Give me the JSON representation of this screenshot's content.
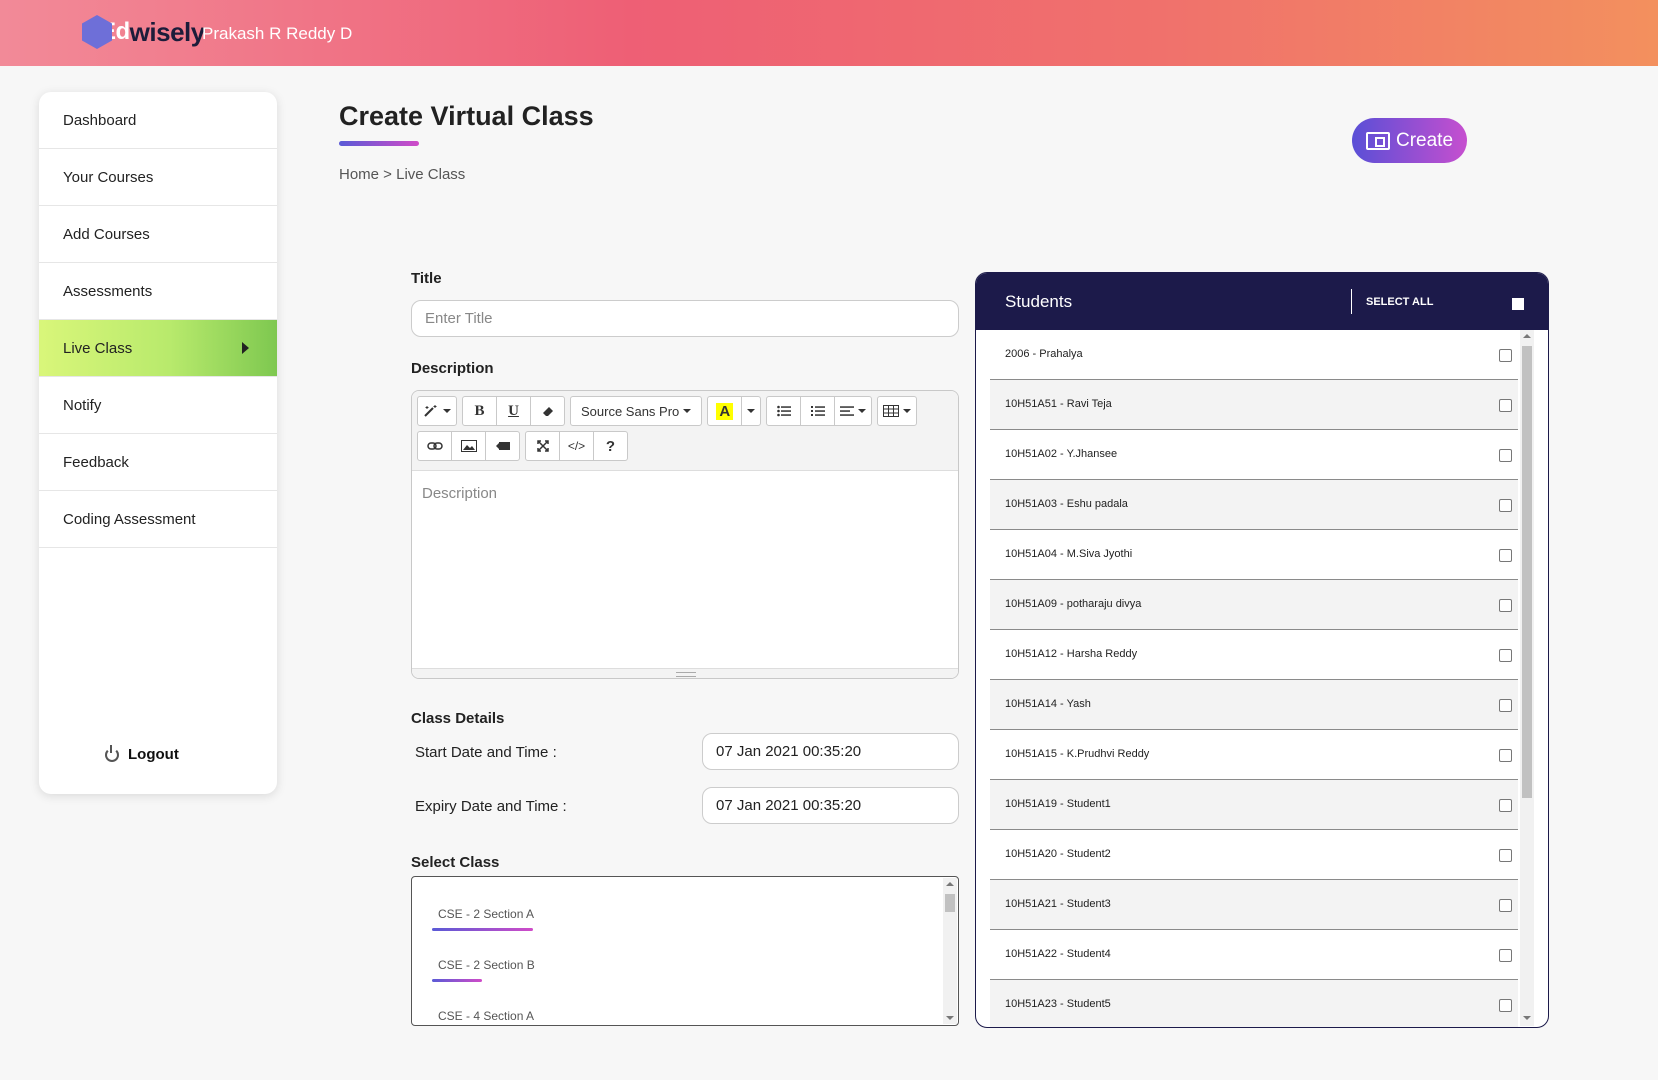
{
  "header": {
    "logo_ed": "Ed",
    "logo_rest": "wisely",
    "username": "Prakash R Reddy D"
  },
  "sidebar": {
    "items": [
      {
        "label": "Dashboard"
      },
      {
        "label": "Your Courses"
      },
      {
        "label": "Add Courses"
      },
      {
        "label": "Assessments"
      },
      {
        "label": "Live Class",
        "active": true
      },
      {
        "label": "Notify"
      },
      {
        "label": "Feedback"
      },
      {
        "label": "Coding Assessment"
      }
    ],
    "logout_label": "Logout"
  },
  "page": {
    "title": "Create Virtual Class",
    "breadcrumb": "Home > Live Class",
    "create_label": "Create"
  },
  "form": {
    "title_label": "Title",
    "title_placeholder": "Enter Title",
    "description_label": "Description",
    "description_placeholder": "Description",
    "font_name": "Source Sans Pro",
    "class_details_label": "Class Details",
    "start_label": "Start Date and Time :",
    "start_value": "07 Jan 2021 00:35:20",
    "expiry_label": "Expiry Date and Time :",
    "expiry_value": "07 Jan 2021 00:35:20",
    "select_class_label": "Select Class",
    "classes": [
      {
        "label": "CSE - 2 Section A"
      },
      {
        "label": "CSE - 2 Section B"
      },
      {
        "label": "CSE - 4 Section A"
      }
    ]
  },
  "students": {
    "title": "Students",
    "select_all_label": "SELECT ALL",
    "list": [
      "2006 - Prahalya",
      "10H51A51 - Ravi Teja",
      "10H51A02 - Y.Jhansee",
      "10H51A03 - Eshu padala",
      "10H51A04 - M.Siva Jyothi",
      "10H51A09 - potharaju divya",
      "10H51A12 - Harsha Reddy",
      "10H51A14 - Yash",
      "10H51A15 - K.Prudhvi Reddy",
      "10H51A19 - Student1",
      "10H51A20 - Student2",
      "10H51A21 - Student3",
      "10H51A22 - Student4",
      "10H51A23 - Student5"
    ]
  },
  "colors": {
    "header_start": "#f28a98",
    "header_end": "#f3905e",
    "active_nav": "#b8ea6c",
    "students_header": "#1c1a4a",
    "accent_gradient_start": "#5a5ad6",
    "accent_gradient_end": "#d04bc8"
  },
  "icons": {
    "toolbar": [
      "magic-icon",
      "bold-icon",
      "underline-icon",
      "eraser-icon",
      "font-color-icon",
      "unordered-list-icon",
      "ordered-list-icon",
      "align-icon",
      "table-icon",
      "link-icon",
      "image-icon",
      "video-icon",
      "fullscreen-icon",
      "code-view-icon",
      "help-icon"
    ],
    "create": "laptop-icon",
    "logout": "power-icon"
  }
}
